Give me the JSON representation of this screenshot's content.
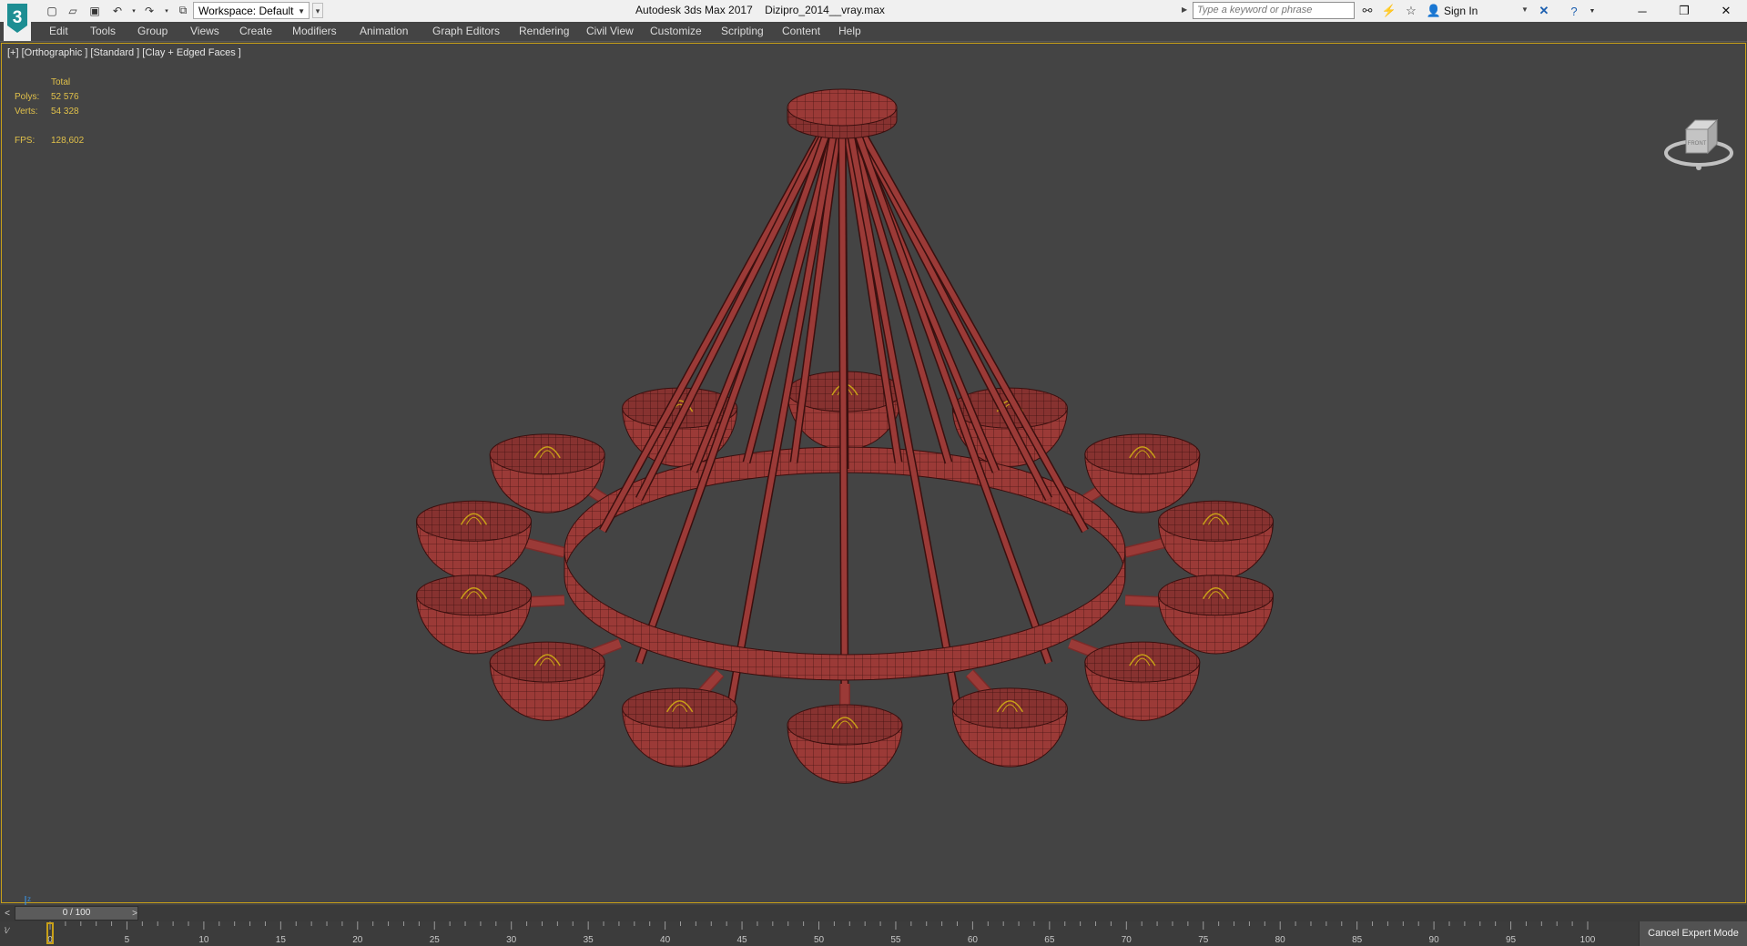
{
  "titlebar": {
    "workspace_label": "Workspace: Default",
    "app_title": "Autodesk 3ds Max 2017",
    "file_name": "Dizipro_2014__vray.max",
    "search_placeholder": "Type a keyword or phrase",
    "sign_in": "Sign In"
  },
  "menu": [
    "Edit",
    "Tools",
    "Group",
    "Views",
    "Create",
    "Modifiers",
    "Animation",
    "Graph Editors",
    "Rendering",
    "Civil View",
    "Customize",
    "Scripting",
    "Content",
    "Help"
  ],
  "viewport": {
    "label": "[+] [Orthographic ] [Standard ] [Clay + Edged Faces ]",
    "stats": {
      "total_label": "Total",
      "polys_label": "Polys:",
      "polys_value": "52 576",
      "verts_label": "Verts:",
      "verts_value": "54 328",
      "fps_label": "FPS:",
      "fps_value": "128,602"
    },
    "viewcube_label": "FRONT",
    "model_color": "#9b3a37",
    "selection_color": "#c8a018"
  },
  "timeline": {
    "slider_text": "0 / 100",
    "current_frame": 0,
    "ticks": [
      "0",
      "5",
      "10",
      "15",
      "20",
      "25",
      "30",
      "35",
      "40",
      "45",
      "50",
      "55",
      "60",
      "65",
      "70",
      "75",
      "80",
      "85",
      "90",
      "95",
      "100"
    ],
    "cancel_expert": "Cancel Expert Mode"
  }
}
